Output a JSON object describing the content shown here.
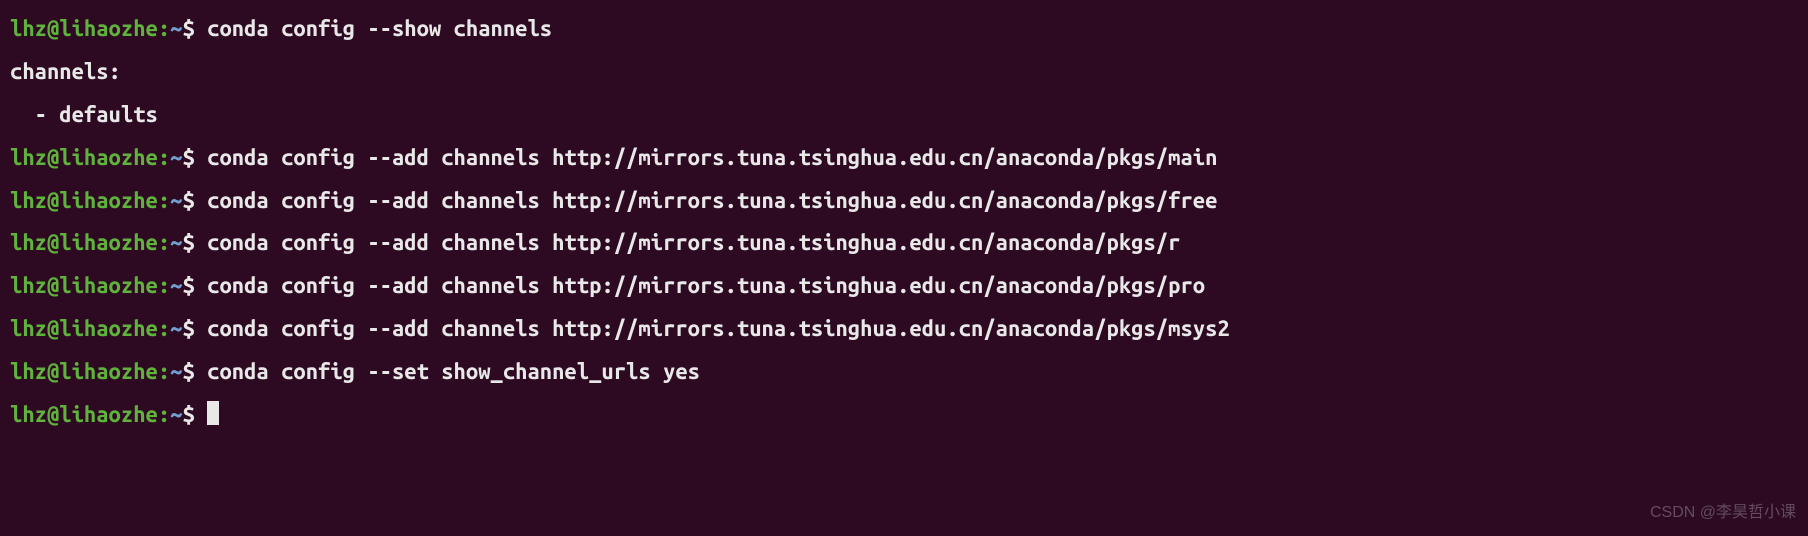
{
  "prompt": {
    "user_host": "lhz@lihaozhe",
    "separator": ":",
    "path": "~",
    "dollar": "$"
  },
  "lines": [
    {
      "type": "cmd",
      "command": "conda config --show channels"
    },
    {
      "type": "out",
      "text": "channels:"
    },
    {
      "type": "out",
      "text": "  - defaults"
    },
    {
      "type": "cmd",
      "command": "conda config --add channels http://mirrors.tuna.tsinghua.edu.cn/anaconda/pkgs/main"
    },
    {
      "type": "cmd",
      "command": "conda config --add channels http://mirrors.tuna.tsinghua.edu.cn/anaconda/pkgs/free"
    },
    {
      "type": "cmd",
      "command": "conda config --add channels http://mirrors.tuna.tsinghua.edu.cn/anaconda/pkgs/r"
    },
    {
      "type": "cmd",
      "command": "conda config --add channels http://mirrors.tuna.tsinghua.edu.cn/anaconda/pkgs/pro"
    },
    {
      "type": "cmd",
      "command": "conda config --add channels http://mirrors.tuna.tsinghua.edu.cn/anaconda/pkgs/msys2"
    },
    {
      "type": "cmd",
      "command": "conda config --set show_channel_urls yes"
    },
    {
      "type": "cursor"
    }
  ],
  "watermark": "CSDN @李昊哲小课"
}
